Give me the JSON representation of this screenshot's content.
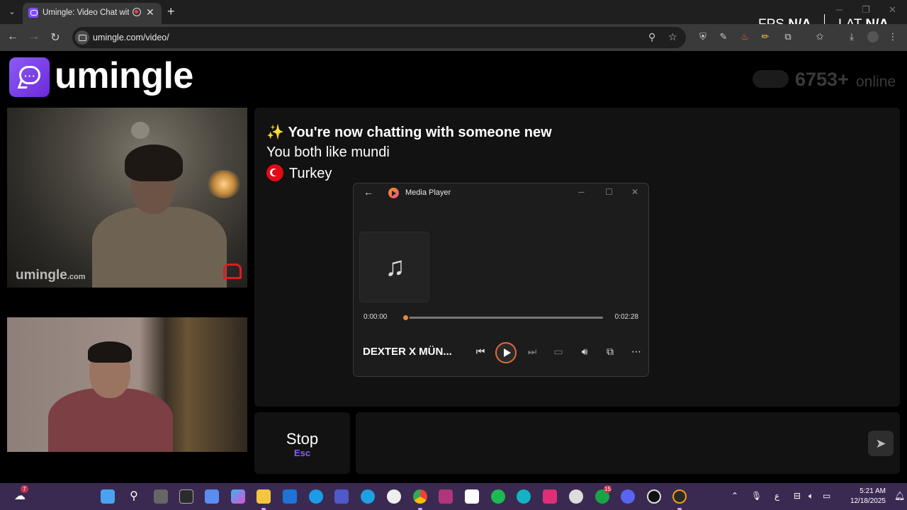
{
  "browser": {
    "tab_title": "Umingle: Video Chat with St",
    "url": "umingle.com/video/",
    "new_tab": "+",
    "tab_close": "✕"
  },
  "overlay_stats": {
    "fps_label": "FPS",
    "fps_value": "N/A",
    "lat_label": "LAT",
    "lat_value": "N/A"
  },
  "site": {
    "logo_text": "umingle",
    "online_count": "6753+",
    "online_word": "online",
    "watermark": "umingle",
    "watermark_suffix": ".com"
  },
  "chat": {
    "sparkle": "✨",
    "headline": "You're now chatting with someone new",
    "interest_line": "You both like mundi",
    "country": "Turkey"
  },
  "controls": {
    "stop_label": "Stop",
    "stop_key": "Esc"
  },
  "media_player": {
    "title": "Media Player",
    "current_time": "0:00:00",
    "total_time": "0:02:28",
    "progress": 0.0,
    "track_name": "DEXTER X MÜN..."
  },
  "taskbar": {
    "notification_badge": "7",
    "discord_badge": "15",
    "clock_time": "5:21 AM",
    "clock_date": "12/18/2025",
    "lang": "ع"
  },
  "colors": {
    "accent_purple": "#8b5cf6",
    "player_accent": "#e28a3c",
    "turkey_red": "#e30a17"
  }
}
